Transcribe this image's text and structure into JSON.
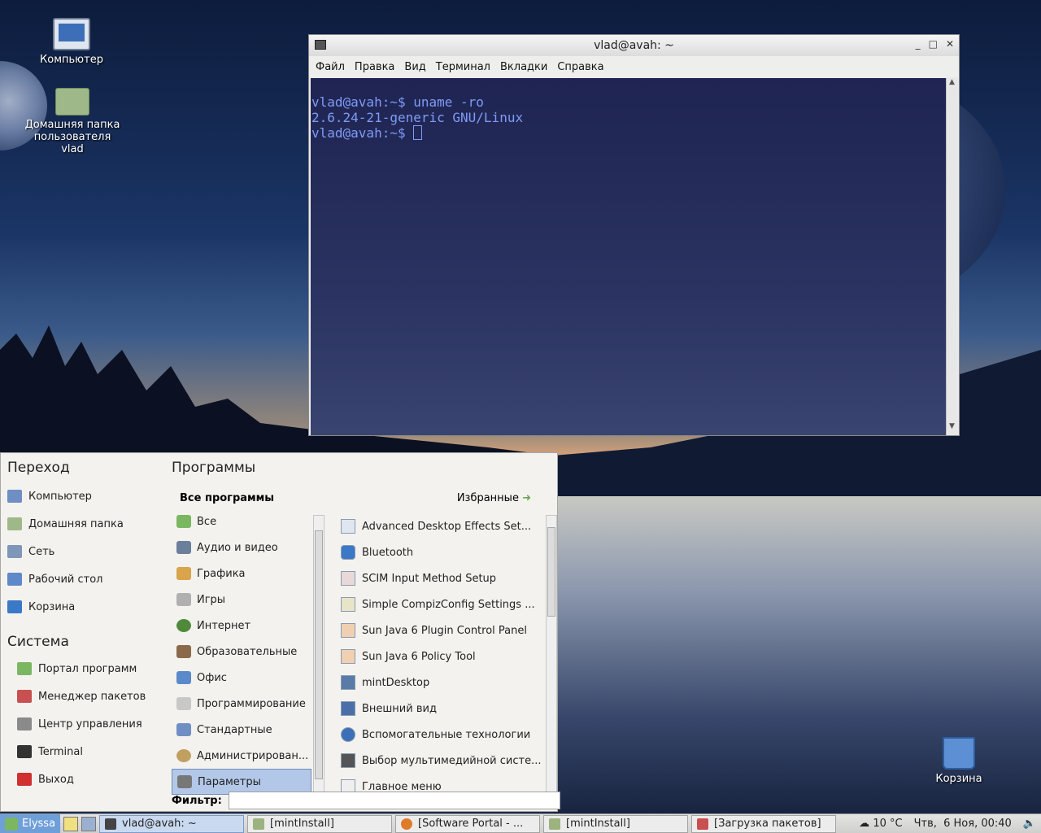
{
  "desktop": {
    "icons": [
      {
        "label": "Компьютер"
      },
      {
        "label": "Домашняя папка пользователя vlad"
      },
      {
        "label": "Корзина"
      }
    ]
  },
  "terminal_window": {
    "title": "vlad@avah: ~",
    "controls": [
      "_",
      "□",
      "✕"
    ],
    "menu": [
      "Файл",
      "Правка",
      "Вид",
      "Терминал",
      "Вкладки",
      "Справка"
    ],
    "lines": [
      "vlad@avah:~$ uname -ro",
      "2.6.24-21-generic GNU/Linux",
      "vlad@avah:~$ "
    ]
  },
  "menu": {
    "places_title": "Переход",
    "places": [
      "Компьютер",
      "Домашняя папка",
      "Сеть",
      "Рабочий стол",
      "Корзина"
    ],
    "system_title": "Система",
    "system": [
      "Портал программ",
      "Менеджер пакетов",
      "Центр управления",
      "Terminal",
      "Выход"
    ],
    "programs_title": "Программы",
    "all_programs": "Все программы",
    "favorites": "Избранные",
    "categories": [
      "Все",
      "Аудио и видео",
      "Графика",
      "Игры",
      "Интернет",
      "Образовательные",
      "Офис",
      "Программирование",
      "Стандартные",
      "Администрирован...",
      "Параметры"
    ],
    "selected_category": "Параметры",
    "apps": [
      "Advanced Desktop Effects Set...",
      "Bluetooth",
      "SCIM Input Method Setup",
      "Simple CompizConfig Settings ...",
      "Sun Java 6 Plugin Control Panel",
      "Sun Java 6 Policy Tool",
      "mintDesktop",
      "Внешний вид",
      "Вспомогательные технологии",
      "Выбор мультимедийной систе...",
      "Главное меню"
    ],
    "filter_label": "Фильтр:"
  },
  "panel": {
    "start_label": "Elyssa",
    "tasks": [
      "vlad@avah: ~",
      "[mintInstall]",
      "[Software Portal - ...",
      "[mintInstall]",
      "[Загрузка пакетов]"
    ],
    "weather": "10 °C",
    "clock": "Чтв,  6 Ноя, 00:40"
  },
  "colors": {
    "terminal_text": "#7f9bf5",
    "selection": "#b3c8e8",
    "panel_start": "#6f9fd8"
  }
}
